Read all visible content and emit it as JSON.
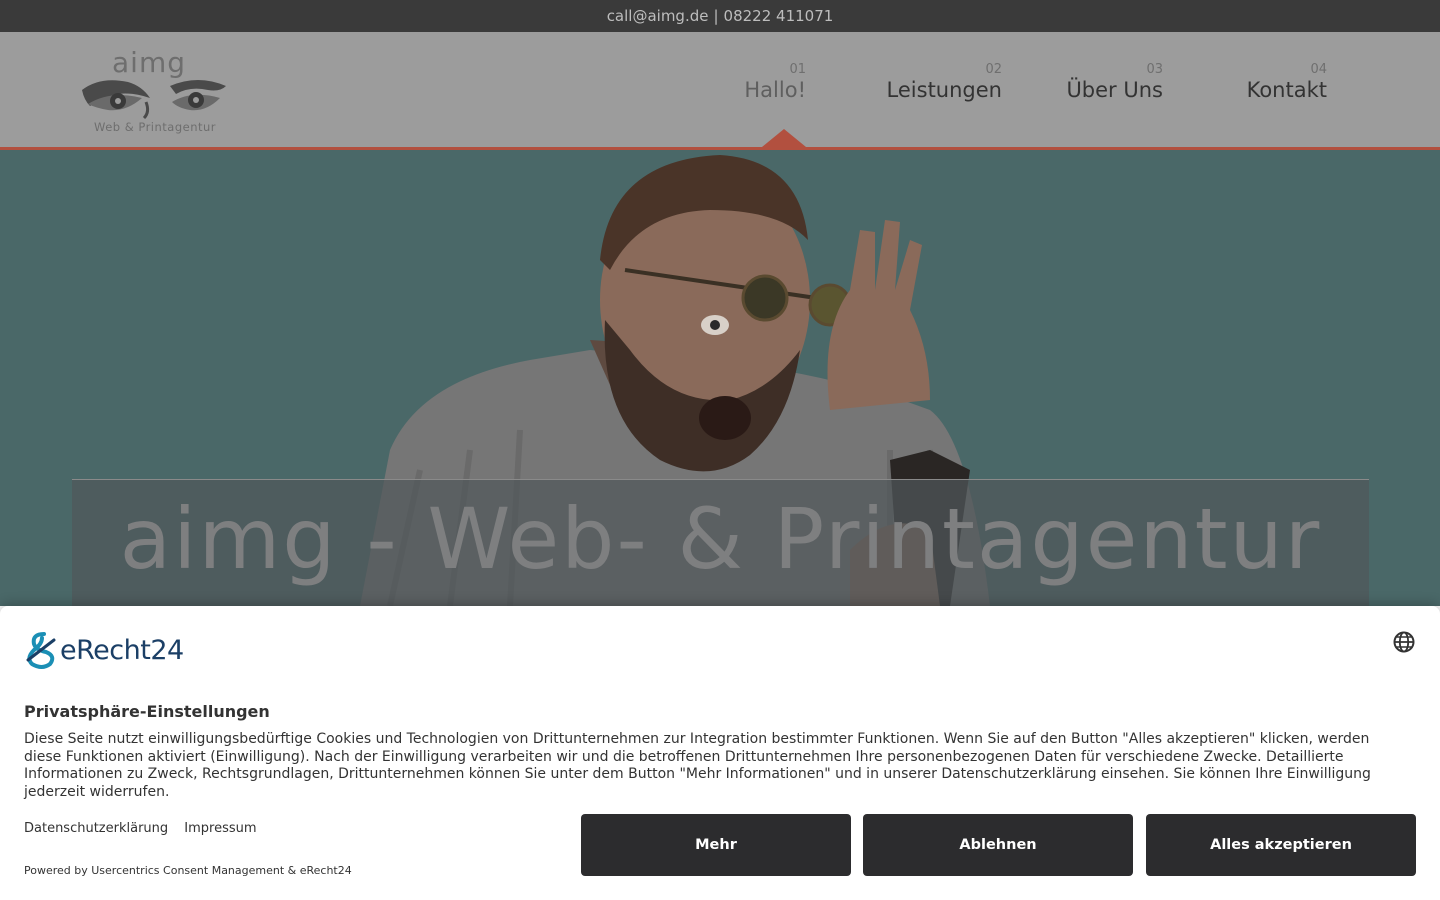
{
  "topbar": {
    "email": "call@aimg.de",
    "separator": "|",
    "phone": "08222 411071"
  },
  "header": {
    "logo": {
      "brand": "aimg",
      "tagline": "Web & Printagentur"
    },
    "nav": [
      {
        "number": "01",
        "label": "Hallo!",
        "active": true
      },
      {
        "number": "02",
        "label": "Leistungen",
        "active": false
      },
      {
        "number": "03",
        "label": "Über Uns",
        "active": false
      },
      {
        "number": "04",
        "label": "Kontakt",
        "active": false
      }
    ]
  },
  "hero": {
    "title": "aimg - Web- & Printagentur"
  },
  "consent": {
    "provider": "eRecht24",
    "title": "Privatsphäre-Einstellungen",
    "text": "Diese Seite nutzt einwilligungsbedürftige Cookies und Technologien von Drittunternehmen zur Integration bestimmter Funktionen. Wenn Sie auf den Button \"Alles akzeptieren\" klicken, werden diese Funktionen aktiviert (Einwilligung). Nach der Einwilligung verarbeiten wir und die betroffenen Drittunternehmen Ihre personenbezogenen Daten für verschiedene Zwecke. Detaillierte Informationen zu Zweck, Rechtsgrundlagen, Drittunternehmen können Sie unter dem Button \"Mehr Informationen\" und in unserer Datenschutzerklärung einsehen. Sie können Ihre Einwilligung jederzeit widerrufen.",
    "links": {
      "privacy": "Datenschutzerklärung",
      "imprint": "Impressum"
    },
    "powered_by": "Powered by Usercentrics Consent Management & eRecht24",
    "buttons": {
      "more": "Mehr",
      "deny": "Ablehnen",
      "accept": "Alles akzeptieren"
    }
  },
  "colors": {
    "accent": "#b2503f",
    "hero_bg": "#4a6868",
    "button_bg": "#2c2c2e",
    "topbar_bg": "#3a3a3a"
  }
}
